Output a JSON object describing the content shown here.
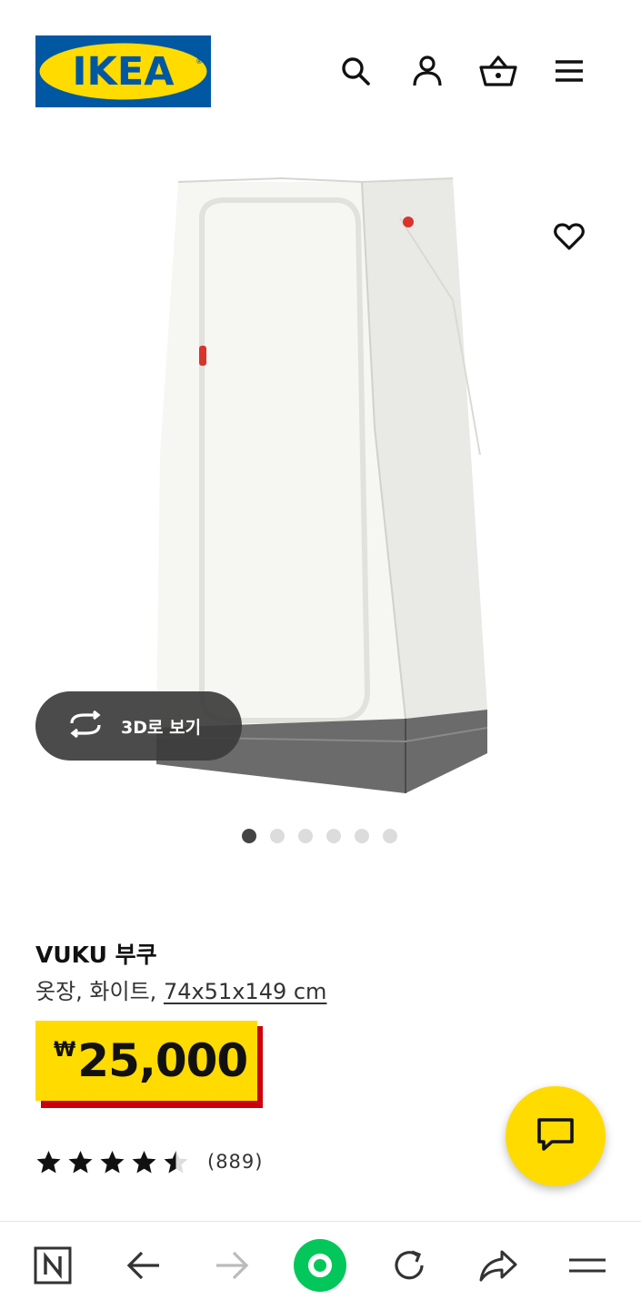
{
  "header": {
    "logo_text": "IKEA",
    "icons": [
      "search-icon",
      "account-icon",
      "cart-icon",
      "menu-icon"
    ]
  },
  "gallery": {
    "view_3d_label": "3D로 보기",
    "dot_count": 6,
    "active_dot": 1
  },
  "product": {
    "name": "VUKU 부쿠",
    "description": "옷장, 화이트,",
    "dimensions": "74x51x149 cm",
    "currency": "₩",
    "price": "25,000",
    "rating": 4.5,
    "rating_max": 5,
    "review_count": "(889)"
  },
  "colors": {
    "brand_blue": "#0058a3",
    "brand_yellow": "#ffdb00",
    "price_red": "#cc0008",
    "badge_dark": "#3c3c3c",
    "browser_green": "#03c75a"
  },
  "browser_bar": {
    "icons": [
      "naver-n-icon",
      "back-arrow-icon",
      "forward-arrow-icon",
      "home-green-circle-icon",
      "refresh-icon",
      "share-icon",
      "menu-lines-icon"
    ]
  }
}
